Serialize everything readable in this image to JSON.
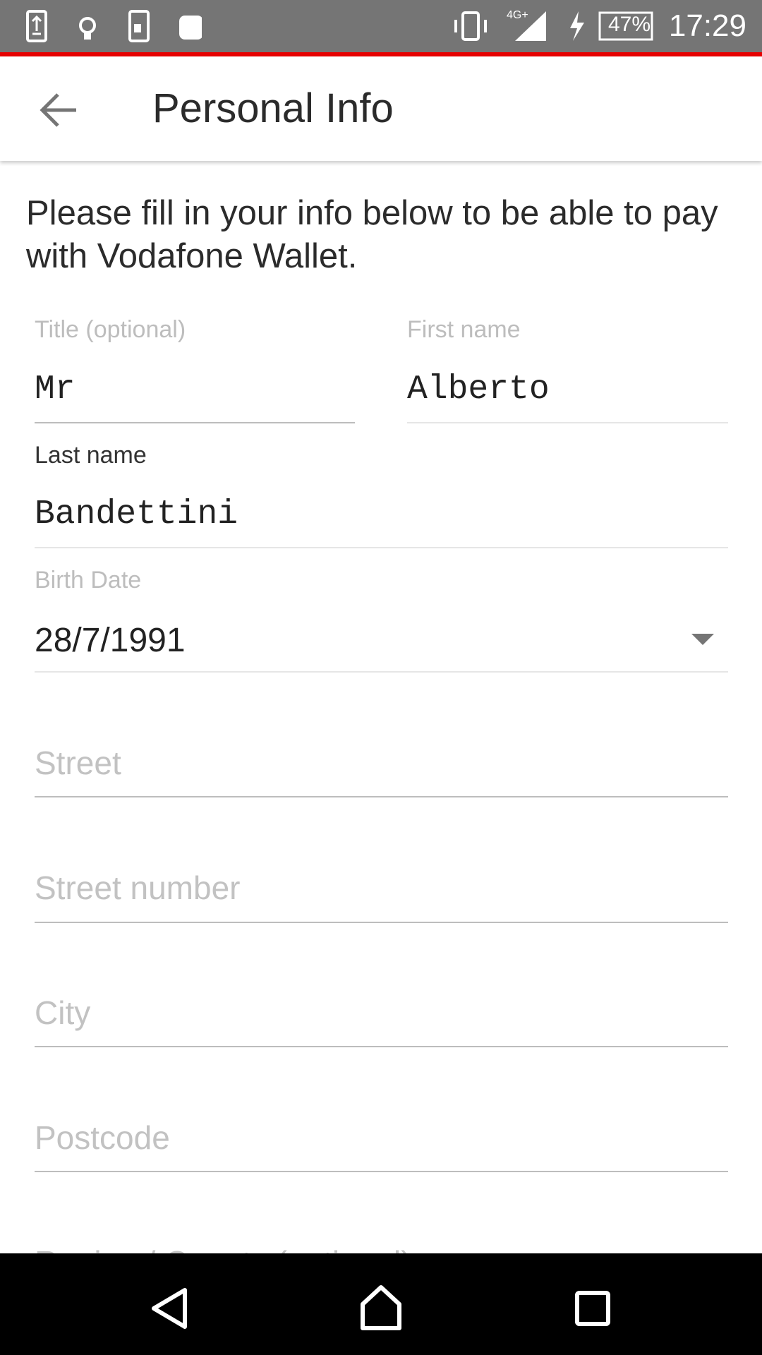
{
  "status_bar": {
    "time": "17:29",
    "battery": "47%",
    "network": "4G+",
    "icons": [
      "upload-icon",
      "lightbulb-icon",
      "screen-mirror-icon",
      "android-icon",
      "vibrate-icon",
      "signal-icon",
      "charging-icon",
      "battery-icon"
    ]
  },
  "toolbar": {
    "title": "Personal Info",
    "back_icon": "arrow-left-icon"
  },
  "intro": "Please fill in your info below to be able to pay with Vodafone Wallet.",
  "form": {
    "title_label": "Title (optional)",
    "title_value": "Mr",
    "first_name_label": "First name",
    "first_name_value": "Alberto",
    "last_name_label": "Last name",
    "last_name_value": "Bandettini",
    "birth_date_label": "Birth Date",
    "birth_date_value": "28/7/1991",
    "street_placeholder": "Street",
    "street_number_placeholder": "Street number",
    "city_placeholder": "City",
    "postcode_placeholder": "Postcode",
    "region_placeholder": "Region / County (optional)"
  },
  "colors": {
    "accent": "#e60000",
    "status_bar": "#757575"
  }
}
